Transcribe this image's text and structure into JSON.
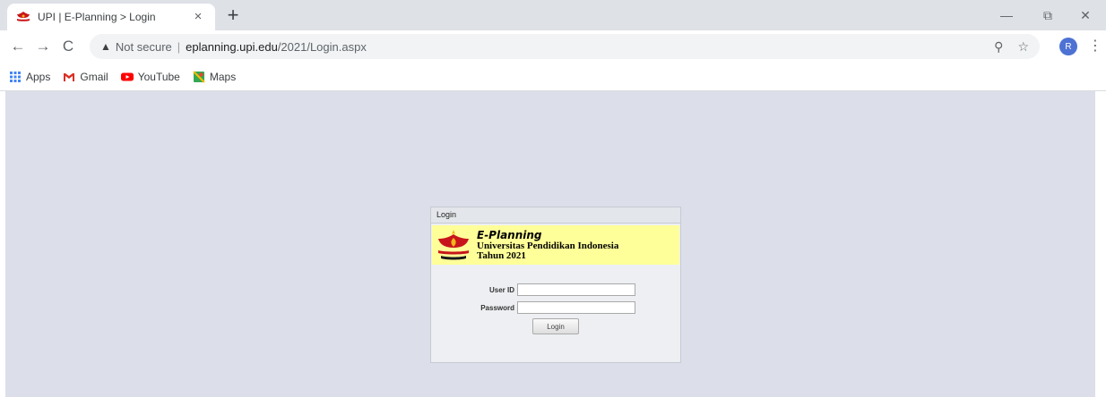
{
  "browser": {
    "tab": {
      "title": "UPI | E-Planning > Login",
      "close_glyph": "×"
    },
    "new_tab_glyph": "+",
    "window_controls": {
      "minimize": "—",
      "maximize": "⧉",
      "close": "✕"
    },
    "nav": {
      "back": "←",
      "forward": "→",
      "reload": "C"
    },
    "address_bar": {
      "security_label": "Not secure",
      "separator": "|",
      "host": "eplanning.upi.edu",
      "path": "/2021/Login.aspx",
      "zoom_glyph": "⚲",
      "star_glyph": "☆"
    },
    "profile_initial": "R",
    "menu_glyph": "⋮",
    "bookmarks": [
      {
        "label": "Apps",
        "icon": "apps-grid-icon"
      },
      {
        "label": "Gmail",
        "icon": "gmail-icon"
      },
      {
        "label": "YouTube",
        "icon": "youtube-icon"
      },
      {
        "label": "Maps",
        "icon": "maps-icon"
      }
    ]
  },
  "login": {
    "header": "Login",
    "brand": "E-Planning",
    "university": "Universitas Pendidikan Indonesia",
    "year": "Tahun 2021",
    "user_id_label": "User ID",
    "user_id_value": "",
    "password_label": "Password",
    "password_value": "",
    "button_label": "Login"
  },
  "colors": {
    "tabstrip": "#dee1e6",
    "page_background": "#dcdee9",
    "banner": "#ffff99",
    "upi_red": "#c8151b",
    "upi_gold": "#f2b51c"
  }
}
